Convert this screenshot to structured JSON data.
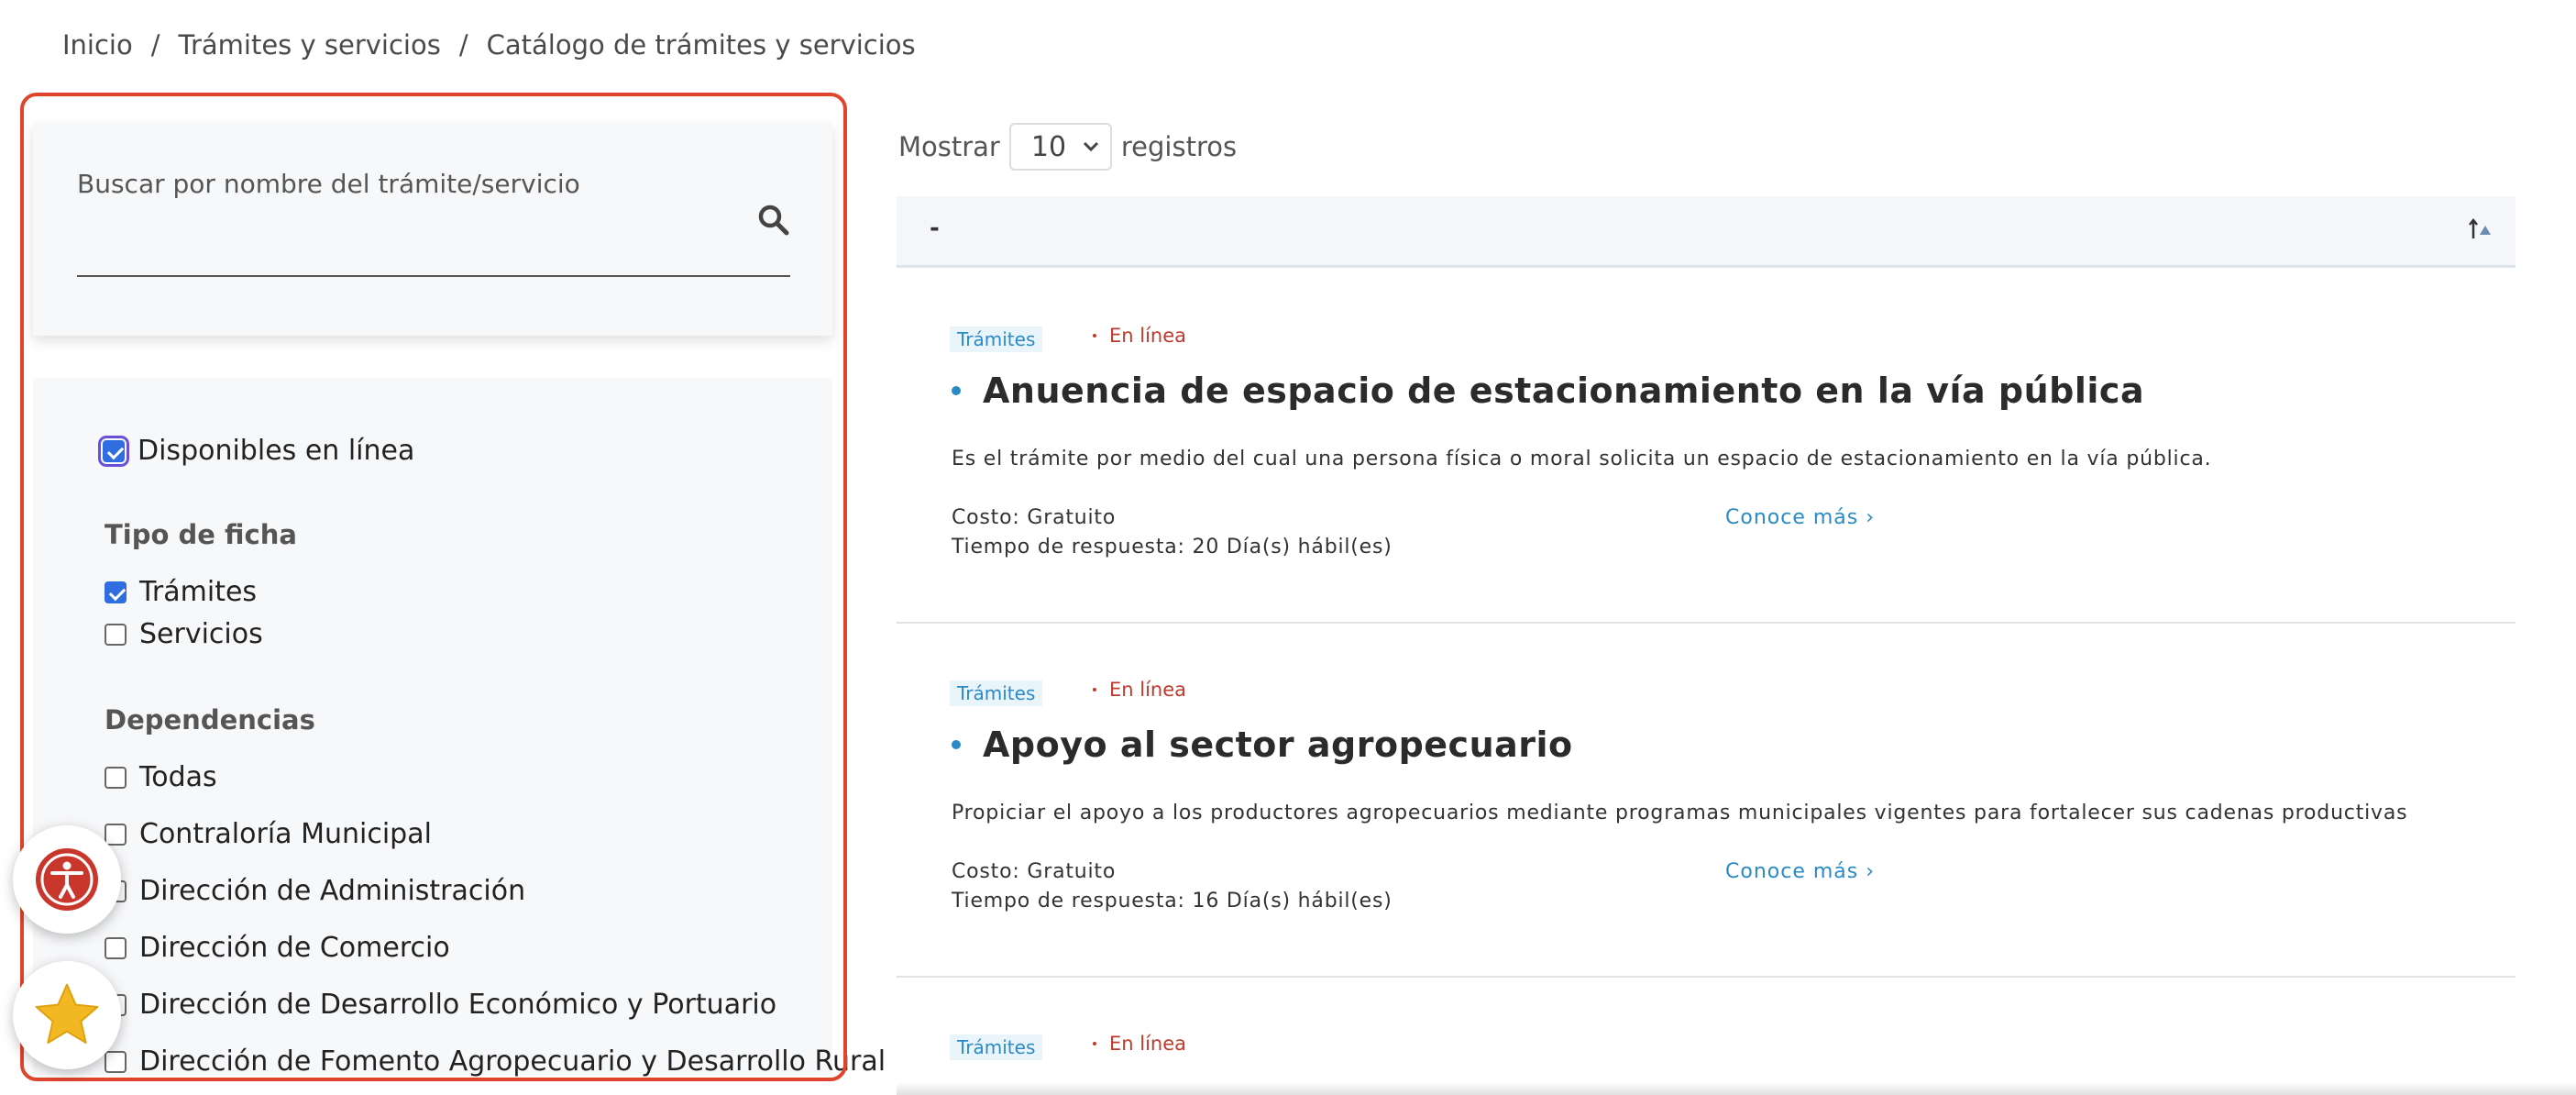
{
  "breadcrumb": {
    "items": [
      "Inicio",
      "Trámites y servicios",
      "Catálogo de trámites y servicios"
    ],
    "separator": "/"
  },
  "search": {
    "label": "Buscar por nombre del trámite/servicio",
    "value": "",
    "icon": "search-icon"
  },
  "filters": {
    "online": {
      "label": "Disponibles en línea",
      "checked": true
    },
    "tipo_title": "Tipo de ficha",
    "tipo": [
      {
        "label": "Trámites",
        "checked": true
      },
      {
        "label": "Servicios",
        "checked": false
      }
    ],
    "dependencias_title": "Dependencias",
    "dependencias": [
      {
        "label": "Todas",
        "checked": false
      },
      {
        "label": "Contraloría Municipal",
        "checked": false
      },
      {
        "label": "Dirección de Administración",
        "checked": false
      },
      {
        "label": "Dirección de Comercio",
        "checked": false
      },
      {
        "label": "Dirección de Desarrollo Económico y Portuario",
        "checked": false
      },
      {
        "label": "Dirección de Fomento Agropecuario y Desarrollo Rural",
        "checked": false
      }
    ]
  },
  "widgets": {
    "accessibility_icon": "accessibility-icon",
    "favorite_icon": "star-icon"
  },
  "table": {
    "show_label": "Mostrar",
    "page_size": "10",
    "records_label": "registros",
    "header_text": "-",
    "sort_icon": "sort-icon"
  },
  "results": [
    {
      "type": "Trámites",
      "status": "En línea",
      "title": "Anuencia de espacio de estacionamiento en la vía pública",
      "description": "Es el trámite por medio del cual una persona física o moral solicita un espacio de estacionamiento en la vía pública.",
      "cost": "Costo: Gratuito",
      "time": "Tiempo de respuesta: 20 Día(s) hábil(es)",
      "more": "Conoce más"
    },
    {
      "type": "Trámites",
      "status": "En línea",
      "title": "Apoyo al sector agropecuario",
      "description": "Propiciar el apoyo a los productores agropecuarios mediante programas municipales vigentes para fortalecer sus cadenas productivas",
      "cost": "Costo: Gratuito",
      "time": "Tiempo de respuesta: 16 Día(s) hábil(es)",
      "more": "Conoce más"
    },
    {
      "type": "Trámites",
      "status": "En línea"
    }
  ],
  "colors": {
    "accent": "#2a8ac6",
    "online": "#c0392b",
    "highlight_outline": "#e0452b",
    "checkbox": "#2f6de1"
  }
}
